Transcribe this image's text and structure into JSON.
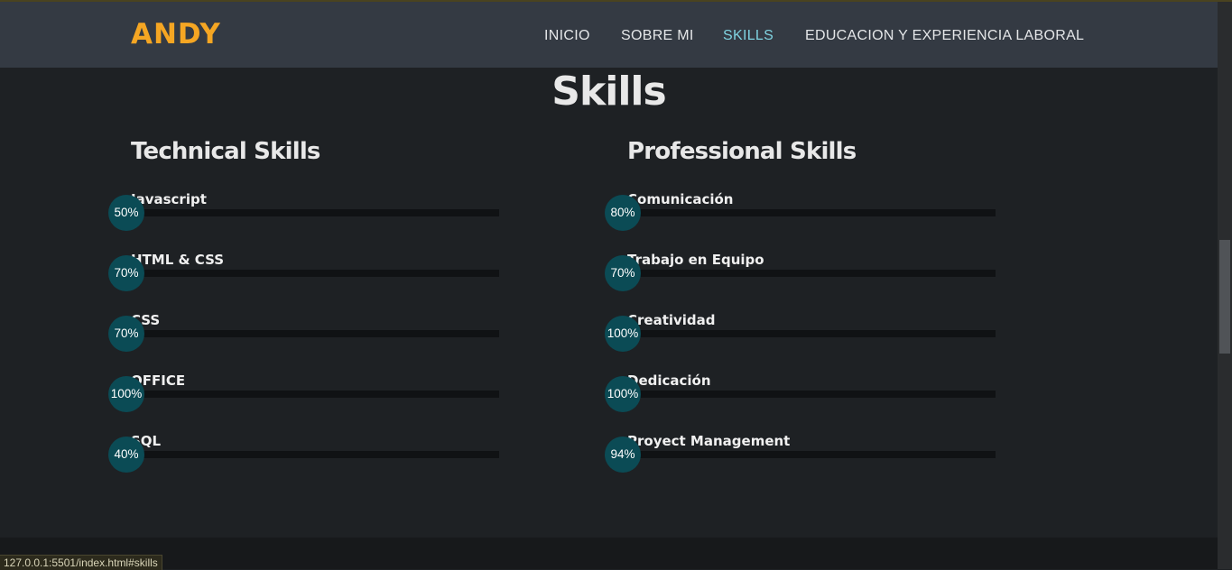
{
  "brand": "ANDY",
  "nav": [
    {
      "label": "INICIO",
      "active": false
    },
    {
      "label": "SOBRE MI",
      "active": false
    },
    {
      "label": "SKILLS",
      "active": true
    },
    {
      "label": "EDUCACION Y EXPERIENCIA LABORAL",
      "active": false
    }
  ],
  "page_title": "Skills",
  "technical": {
    "heading": "Technical Skills",
    "items": [
      {
        "name": "Javascript",
        "percent_label": "50%",
        "percent": 50
      },
      {
        "name": "HTML & CSS",
        "percent_label": "70%",
        "percent": 70
      },
      {
        "name": "CSS",
        "percent_label": "70%",
        "percent": 70
      },
      {
        "name": "OFFICE",
        "percent_label": "100%",
        "percent": 100
      },
      {
        "name": "SQL",
        "percent_label": "40%",
        "percent": 40
      }
    ]
  },
  "professional": {
    "heading": "Professional Skills",
    "items": [
      {
        "name": "Comunicación",
        "percent_label": "80%",
        "percent": 80
      },
      {
        "name": "Trabajo en Equipo",
        "percent_label": "70%",
        "percent": 70
      },
      {
        "name": "Creatividad",
        "percent_label": "100%",
        "percent": 100
      },
      {
        "name": "Dedicación",
        "percent_label": "100%",
        "percent": 100
      },
      {
        "name": "Proyect Management",
        "percent_label": "94%",
        "percent": 94
      }
    ]
  },
  "status_url": "127.0.0.1:5501/index.html#skills",
  "colors": {
    "brand": "#f5a623",
    "nav_active": "#7fd3e0",
    "badge": "#0b4b55",
    "navbar_bg": "#343a43",
    "page_bg": "#1e2124"
  }
}
